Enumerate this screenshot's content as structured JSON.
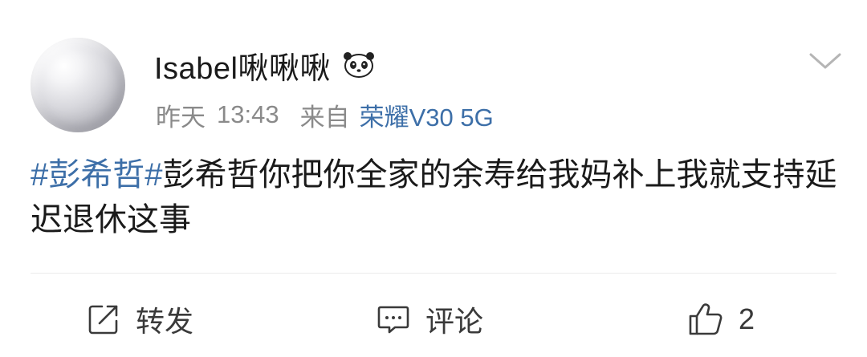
{
  "post": {
    "username": "Isabel啾啾啾",
    "badge_icon": "panda-icon",
    "date": "昨天",
    "time": "13:43",
    "from_label": "来自",
    "device": "荣耀V30 5G",
    "menu_icon": "chevron-down-icon",
    "content": {
      "hashtag": "#彭希哲#",
      "text": "彭希哲你把你全家的余寿给我妈补上我就支持延迟退休这事"
    }
  },
  "actions": {
    "repost": {
      "icon": "share-icon",
      "label": "转发"
    },
    "comment": {
      "icon": "comment-icon",
      "label": "评论"
    },
    "like": {
      "icon": "thumbs-up-icon",
      "count": "2"
    }
  },
  "colors": {
    "link": "#3d6fa8",
    "meta": "#8a8a8a",
    "text": "#1a1a1a"
  }
}
